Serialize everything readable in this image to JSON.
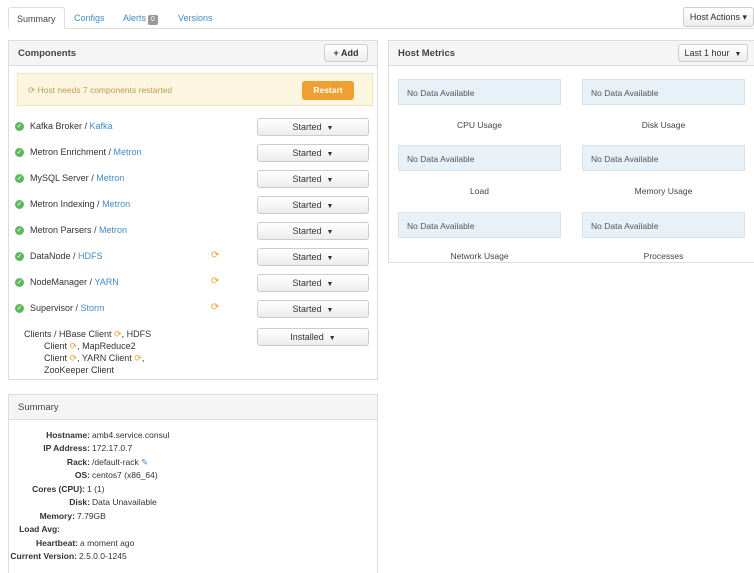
{
  "tabs": [
    {
      "label": "Summary"
    },
    {
      "label": "Configs"
    },
    {
      "label": "Alerts",
      "badge": "0"
    },
    {
      "label": "Versions"
    }
  ],
  "host_actions": {
    "label": "Host Actions",
    "caret": "▾"
  },
  "components": {
    "title": "Components",
    "add_label": "+ Add",
    "restart_notice": "Host needs 7 components restarted",
    "restart_label": "Restart",
    "rows": [
      {
        "name": "Kafka Broker",
        "service": "Kafka",
        "state": "Started",
        "restart": false
      },
      {
        "name": "Metron Enrichment",
        "service": "Metron",
        "state": "Started",
        "restart": false
      },
      {
        "name": "MySQL Server",
        "service": "Metron",
        "state": "Started",
        "restart": false
      },
      {
        "name": "Metron Indexing",
        "service": "Metron",
        "state": "Started",
        "restart": false
      },
      {
        "name": "Metron Parsers",
        "service": "Metron",
        "state": "Started",
        "restart": false
      },
      {
        "name": "DataNode",
        "service": "HDFS",
        "state": "Started",
        "restart": true
      },
      {
        "name": "NodeManager",
        "service": "YARN",
        "state": "Started",
        "restart": true
      },
      {
        "name": "Supervisor",
        "service": "Storm",
        "state": "Started",
        "restart": true
      }
    ],
    "clients": {
      "prefix": "Clients / HBase Client",
      "hdfs": "HDFS",
      "client1": "Client",
      "mapreduce": "MapReduce2",
      "client2": "Client",
      "yarn": "YARN Client",
      "zookeeper": "ZooKeeper Client",
      "state": "Installed"
    }
  },
  "summary": {
    "title": "Summary",
    "rows": [
      {
        "key": "Hostname:",
        "value": "amb4.service.consul"
      },
      {
        "key": "IP Address:",
        "value": "172.17.0.7"
      },
      {
        "key": "Rack:",
        "value": "/default-rack"
      },
      {
        "key": "OS:",
        "value": "centos7 (x86_64)"
      },
      {
        "key": "Cores (CPU):",
        "value": "1 (1)"
      },
      {
        "key": "Disk:",
        "value": "Data Unavailable"
      },
      {
        "key": "Memory:",
        "value": "7.79GB"
      },
      {
        "key": "Load Avg:",
        "value": ""
      },
      {
        "key": "Heartbeat:",
        "value": "a moment ago"
      },
      {
        "key": "Current Version:",
        "value": "2.5.0.0-1245"
      }
    ]
  },
  "host_metrics": {
    "title": "Host Metrics",
    "range_label": "Last 1 hour",
    "metrics": [
      {
        "status": "No Data Available",
        "label": "CPU Usage"
      },
      {
        "status": "No Data Available",
        "label": "Disk Usage"
      },
      {
        "status": "No Data Available",
        "label": "Load"
      },
      {
        "status": "No Data Available",
        "label": "Memory Usage"
      },
      {
        "status": "No Data Available",
        "label": "Network Usage"
      },
      {
        "status": "No Data Available",
        "label": "Processes"
      }
    ]
  },
  "colors": {
    "accent": "#428bca",
    "ok": "#5cb85c",
    "warning": "#f0a030"
  }
}
